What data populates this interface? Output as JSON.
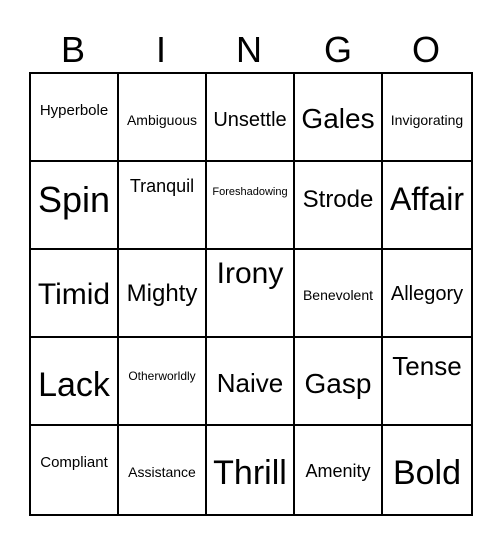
{
  "header": {
    "letters": [
      "B",
      "I",
      "N",
      "G",
      "O"
    ]
  },
  "cells": [
    [
      "Hyperbole",
      "Ambiguous",
      "Unsettle",
      "Gales",
      "Invigorating"
    ],
    [
      "Spin",
      "Tranquil",
      "Foreshadowing",
      "Strode",
      "Affair"
    ],
    [
      "Timid",
      "Mighty",
      "Irony",
      "Benevolent",
      "Allegory"
    ],
    [
      "Lack",
      "Otherworldly",
      "Naive",
      "Gasp",
      "Tense"
    ],
    [
      "Compliant",
      "Assistance",
      "Thrill",
      "Amenity",
      "Bold"
    ]
  ]
}
